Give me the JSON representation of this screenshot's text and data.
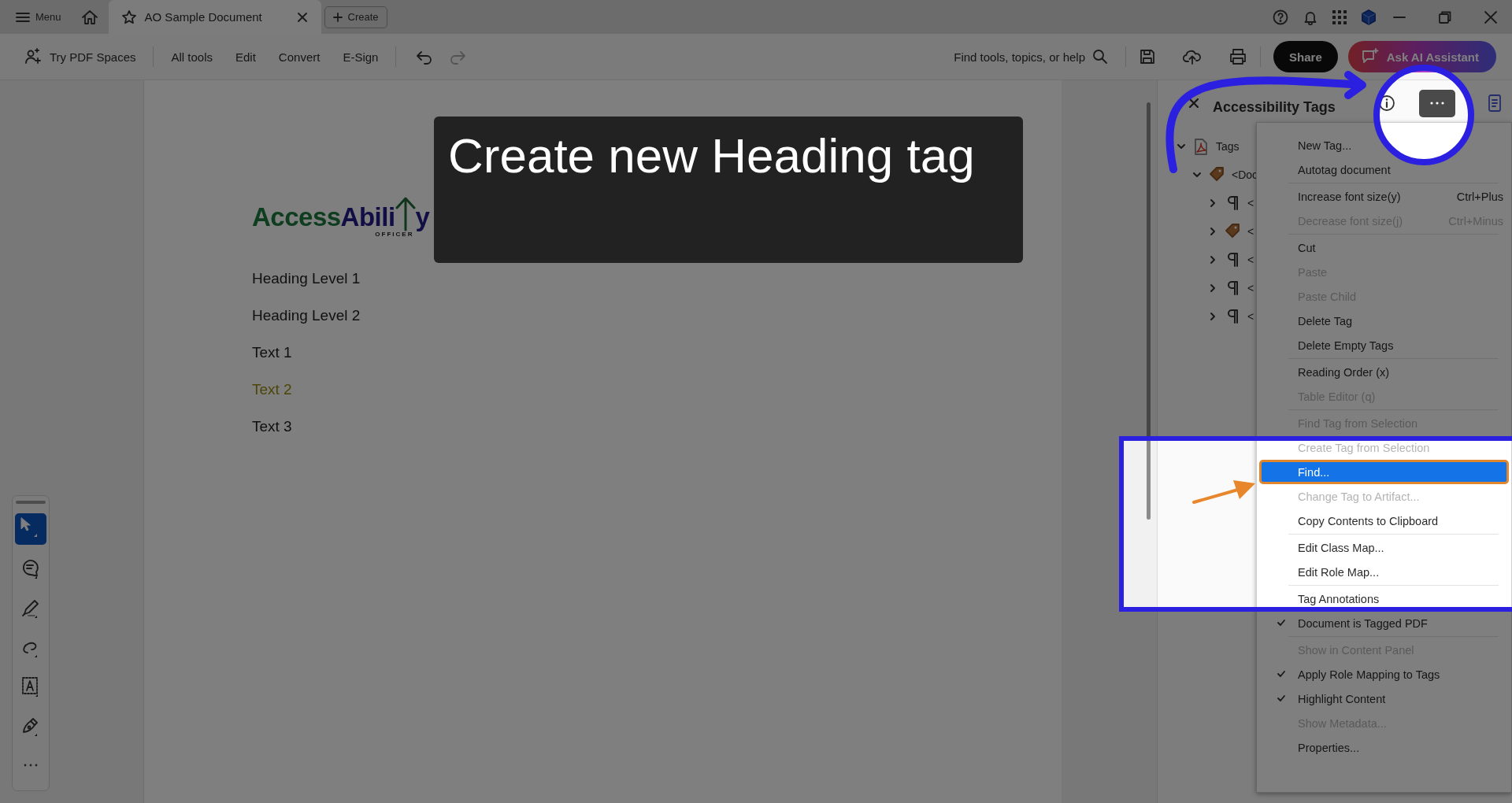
{
  "title_bar": {
    "menu_label": "Menu",
    "tab": {
      "title": "AO Sample Document",
      "selected": true
    },
    "create_button": "Create"
  },
  "toolbar": {
    "spaces_button": "Try PDF Spaces",
    "tools": [
      {
        "label": "All tools"
      },
      {
        "label": "Edit"
      },
      {
        "label": "Convert"
      },
      {
        "label": "E-Sign"
      }
    ],
    "undo": {
      "disabled": false
    },
    "redo": {
      "disabled": true
    },
    "search_label": "Find tools, topics, or help",
    "share_button": "Share",
    "assistant_button": "Ask AI Assistant"
  },
  "tool_rail": [
    {
      "kind": "select",
      "selected": true
    },
    {
      "kind": "comment",
      "selected": false
    },
    {
      "kind": "highlight",
      "selected": false
    },
    {
      "kind": "draw",
      "selected": false
    },
    {
      "kind": "text",
      "selected": false
    },
    {
      "kind": "sign",
      "selected": false
    },
    {
      "kind": "more",
      "selected": false
    }
  ],
  "document": {
    "logo": {
      "first": "Access",
      "second": "Abili",
      "last": "y",
      "tagline": "OFFICER"
    },
    "lines": [
      {
        "text": "Heading Level 1",
        "kind": "plain"
      },
      {
        "text": "Heading Level 2",
        "kind": "plain"
      },
      {
        "text": "Text 1",
        "kind": "plain"
      },
      {
        "text": "Text 2",
        "kind": "marked"
      },
      {
        "text": "Text 3",
        "kind": "plain"
      }
    ]
  },
  "caption": "Create new Heading tag",
  "panel": {
    "title": "Accessibility Tags",
    "tree": [
      {
        "label": "Tags",
        "kind": "root",
        "expanded": true,
        "children": [
          {
            "label": "<Doc",
            "kind": "tag",
            "expanded": true,
            "children": [
              {
                "label": "<",
                "kind": "paragraph",
                "expanded": false
              },
              {
                "label": "<",
                "kind": "tag",
                "expanded": false
              },
              {
                "label": "<",
                "kind": "paragraph",
                "expanded": false
              },
              {
                "label": "<",
                "kind": "paragraph",
                "expanded": false
              },
              {
                "label": "<",
                "kind": "paragraph",
                "expanded": false
              }
            ]
          }
        ]
      }
    ]
  },
  "menu": {
    "groups": [
      [
        {
          "label": "New Tag...",
          "disabled": false,
          "checked": false,
          "selected": false
        },
        {
          "label": "Autotag document",
          "disabled": false,
          "checked": false,
          "selected": false
        }
      ],
      [
        {
          "label": "Increase font size(y)",
          "shortcut": "Ctrl+Plus",
          "disabled": false,
          "checked": false,
          "selected": false
        },
        {
          "label": "Decrease font size(j)",
          "shortcut": "Ctrl+Minus",
          "disabled": true,
          "checked": false,
          "selected": false
        }
      ],
      [
        {
          "label": "Cut",
          "disabled": false,
          "checked": false,
          "selected": false
        },
        {
          "label": "Paste",
          "disabled": true,
          "checked": false,
          "selected": false
        },
        {
          "label": "Paste Child",
          "disabled": true,
          "checked": false,
          "selected": false
        },
        {
          "label": "Delete Tag",
          "disabled": false,
          "checked": false,
          "selected": false
        },
        {
          "label": "Delete Empty Tags",
          "disabled": false,
          "checked": false,
          "selected": false
        }
      ],
      [
        {
          "label": "Reading Order (x)",
          "disabled": false,
          "checked": false,
          "selected": false
        },
        {
          "label": "Table Editor (q)",
          "disabled": true,
          "checked": false,
          "selected": false
        }
      ],
      [
        {
          "label": "Find Tag from Selection",
          "disabled": true,
          "checked": false,
          "selected": false
        },
        {
          "label": "Create Tag from Selection",
          "disabled": true,
          "checked": false,
          "selected": false
        },
        {
          "label": "Find...",
          "disabled": false,
          "checked": false,
          "selected": true
        },
        {
          "label": "Change Tag to Artifact...",
          "disabled": true,
          "checked": false,
          "selected": false
        },
        {
          "label": "Copy Contents to Clipboard",
          "disabled": false,
          "checked": false,
          "selected": false
        }
      ],
      [
        {
          "label": "Edit Class Map...",
          "disabled": false,
          "checked": false,
          "selected": false
        },
        {
          "label": "Edit Role Map...",
          "disabled": false,
          "checked": false,
          "selected": false
        }
      ],
      [
        {
          "label": "Tag Annotations",
          "disabled": false,
          "checked": false,
          "selected": false
        },
        {
          "label": "Document is Tagged PDF",
          "disabled": false,
          "checked": true,
          "selected": false
        }
      ],
      [
        {
          "label": "Show in Content Panel",
          "disabled": true,
          "checked": false,
          "selected": false
        },
        {
          "label": "Apply Role Mapping to Tags",
          "disabled": false,
          "checked": true,
          "selected": false
        },
        {
          "label": "Highlight Content",
          "disabled": false,
          "checked": true,
          "selected": false
        },
        {
          "label": "Show Metadata...",
          "disabled": true,
          "checked": false,
          "selected": false
        },
        {
          "label": "Properties...",
          "disabled": false,
          "checked": false,
          "selected": false
        }
      ]
    ]
  }
}
